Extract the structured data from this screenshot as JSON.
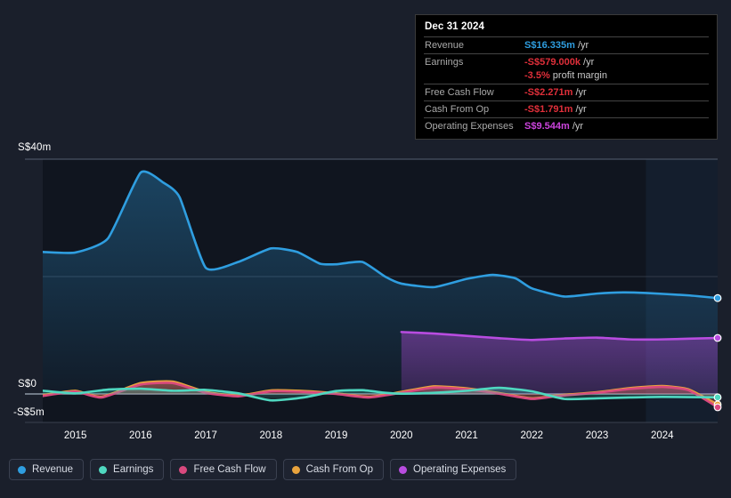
{
  "tooltip": {
    "date": "Dec 31 2024",
    "rows": [
      {
        "key": "Revenue",
        "value": "S$16.335m",
        "unit": "/yr",
        "color": "#2f9ee0"
      },
      {
        "key": "Earnings",
        "value": "-S$579.000k",
        "unit": "/yr",
        "color": "#e02f3a"
      },
      {
        "key": "",
        "value": "-3.5%",
        "unit": "profit margin",
        "color": "#e02f3a"
      },
      {
        "key": "Free Cash Flow",
        "value": "-S$2.271m",
        "unit": "/yr",
        "color": "#e02f3a"
      },
      {
        "key": "Cash From Op",
        "value": "-S$1.791m",
        "unit": "/yr",
        "color": "#e02f3a"
      },
      {
        "key": "Operating Expenses",
        "value": "S$9.544m",
        "unit": "/yr",
        "color": "#cc44dd"
      }
    ]
  },
  "legend": [
    {
      "label": "Revenue",
      "color": "#2f9ee0"
    },
    {
      "label": "Earnings",
      "color": "#4fd8c0"
    },
    {
      "label": "Free Cash Flow",
      "color": "#d9497e"
    },
    {
      "label": "Cash From Op",
      "color": "#e8a33d"
    },
    {
      "label": "Operating Expenses",
      "color": "#b84ce0"
    }
  ],
  "chart_data": {
    "type": "area",
    "title": "",
    "xlabel": "",
    "ylabel": "",
    "currency": "S$",
    "ylim": [
      -5,
      40
    ],
    "yticks": [
      40,
      0,
      -5
    ],
    "ytick_labels": [
      "S$40m",
      "S$0",
      "-S$5m"
    ],
    "grid": true,
    "legend_position": "bottom",
    "xticks": [
      2015,
      2016,
      2017,
      2018,
      2019,
      2020,
      2021,
      2022,
      2023,
      2024
    ],
    "xtick_labels": [
      "2015",
      "2016",
      "2017",
      "2018",
      "2019",
      "2020",
      "2021",
      "2022",
      "2023",
      "2024"
    ],
    "xlim": [
      2014.5,
      2024.85
    ],
    "highlight_band": [
      2023.75,
      2024.85
    ],
    "series": [
      {
        "name": "Revenue",
        "color": "#2f9ee0",
        "x": [
          2014.5,
          2015.0,
          2015.5,
          2016.0,
          2016.35,
          2016.6,
          2017.0,
          2017.5,
          2018.0,
          2018.4,
          2018.75,
          2019.0,
          2019.4,
          2019.75,
          2020.0,
          2020.5,
          2021.0,
          2021.4,
          2021.75,
          2022.0,
          2022.5,
          2023.0,
          2023.4,
          2023.75,
          2024.4,
          2024.85
        ],
        "y": [
          24.2,
          24.1,
          26.5,
          37.7,
          36.0,
          33.5,
          21.5,
          22.5,
          24.8,
          24.2,
          22.2,
          22.1,
          22.5,
          20.0,
          18.8,
          18.2,
          19.6,
          20.3,
          19.7,
          18.0,
          16.6,
          17.1,
          17.3,
          17.2,
          16.8,
          16.335
        ]
      },
      {
        "name": "Operating Expenses",
        "color": "#b84ce0",
        "x": [
          2020.0,
          2020.5,
          2021.0,
          2021.5,
          2022.0,
          2022.5,
          2023.0,
          2023.5,
          2024.0,
          2024.85
        ],
        "y": [
          10.55,
          10.3,
          9.9,
          9.5,
          9.2,
          9.45,
          9.6,
          9.3,
          9.3,
          9.544
        ]
      },
      {
        "name": "Cash From Op",
        "color": "#e8a33d",
        "x": [
          2014.5,
          2015.0,
          2015.4,
          2016.0,
          2016.5,
          2017.0,
          2017.5,
          2018.0,
          2018.5,
          2019.0,
          2019.5,
          2020.0,
          2020.5,
          2021.0,
          2021.5,
          2022.0,
          2022.4,
          2023.0,
          2023.5,
          2024.0,
          2024.4,
          2024.85
        ],
        "y": [
          -0.2,
          0.55,
          -0.5,
          1.85,
          2.1,
          0.35,
          -0.3,
          0.6,
          0.5,
          0.1,
          -0.5,
          0.35,
          1.3,
          0.95,
          0.15,
          -0.75,
          -0.25,
          0.3,
          1.0,
          1.35,
          0.8,
          -1.791
        ]
      },
      {
        "name": "Earnings",
        "color": "#4fd8c0",
        "x": [
          2014.5,
          2015.0,
          2015.5,
          2016.0,
          2016.5,
          2017.0,
          2017.5,
          2018.0,
          2018.5,
          2019.0,
          2019.4,
          2019.75,
          2020.0,
          2020.5,
          2021.0,
          2021.5,
          2022.0,
          2022.5,
          2023.0,
          2023.5,
          2024.0,
          2024.85
        ],
        "y": [
          0.55,
          0.1,
          0.75,
          0.9,
          0.55,
          0.7,
          0.1,
          -1.1,
          -0.6,
          0.5,
          0.65,
          0.2,
          0.05,
          0.2,
          0.55,
          1.05,
          0.45,
          -0.85,
          -0.75,
          -0.6,
          -0.5,
          -0.579
        ]
      },
      {
        "name": "Free Cash Flow",
        "color": "#d9497e",
        "x": [
          2014.5,
          2015.0,
          2015.4,
          2016.0,
          2016.5,
          2017.0,
          2017.5,
          2018.0,
          2018.5,
          2019.0,
          2019.5,
          2020.0,
          2020.5,
          2021.0,
          2021.5,
          2022.0,
          2022.4,
          2023.0,
          2023.5,
          2024.0,
          2024.4,
          2024.85
        ],
        "y": [
          -0.35,
          0.4,
          -0.6,
          1.6,
          1.85,
          0.2,
          -0.4,
          0.45,
          0.35,
          0.0,
          -0.6,
          0.2,
          1.1,
          0.8,
          0.05,
          -0.85,
          -0.35,
          0.2,
          0.85,
          1.2,
          0.65,
          -2.271
        ]
      }
    ],
    "endpoints": [
      {
        "name": "Revenue",
        "color": "#2f9ee0",
        "value": 16.335
      },
      {
        "name": "Operating Expenses",
        "color": "#b84ce0",
        "value": 9.544
      },
      {
        "name": "Earnings",
        "color": "#4fd8c0",
        "value": -0.579
      },
      {
        "name": "Cash From Op",
        "color": "#e8a33d",
        "value": -1.791
      },
      {
        "name": "Free Cash Flow",
        "color": "#d9497e",
        "value": -2.271
      }
    ]
  }
}
